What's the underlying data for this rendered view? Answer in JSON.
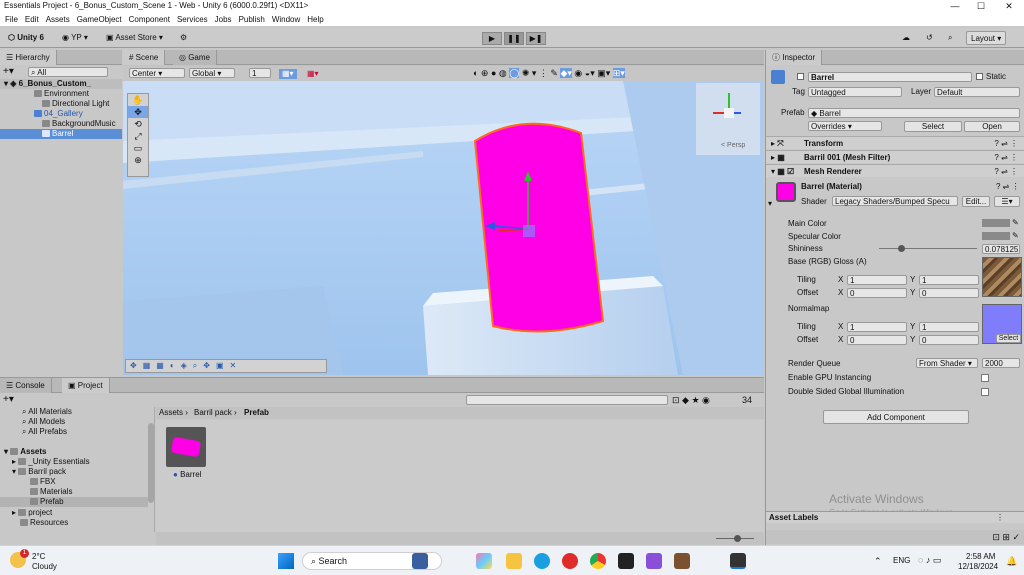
{
  "window": {
    "title": "Essentials Project - 6_Bonus_Custom_Scene 1 - Web - Unity 6 (6000.0.29f1) <DX11>",
    "min": "—",
    "max": "☐",
    "close": "✕"
  },
  "menu": [
    "File",
    "Edit",
    "Assets",
    "GameObject",
    "Component",
    "Services",
    "Jobs",
    "Publish",
    "Window",
    "Help"
  ],
  "toolbar": {
    "unity": "Unity 6",
    "account": "YP",
    "store": "Asset Store",
    "layout": "Layout"
  },
  "hierarchy": {
    "tab": "Hierarchy",
    "search_placeholder": "All",
    "scene": "6_Bonus_Custom_",
    "items": [
      "Environment",
      "Directional Light",
      "04_Gallery",
      "BackgroundMusic",
      "Barrel"
    ]
  },
  "scene": {
    "tab_scene": "Scene",
    "tab_game": "Game",
    "pivot": "Center",
    "space": "Global",
    "snap": "1",
    "gizmo_label": "< Persp"
  },
  "inspector": {
    "tab": "Inspector",
    "object_name": "Barrel",
    "static": "Static",
    "tag_label": "Tag",
    "tag": "Untagged",
    "layer_label": "Layer",
    "layer": "Default",
    "prefab_label": "Prefab",
    "prefab": "Barrel",
    "overrides": "Overrides",
    "select": "Select",
    "open": "Open",
    "components": [
      "Transform",
      "Barril 001 (Mesh Filter)",
      "Mesh Renderer"
    ],
    "material": "Barrel (Material)",
    "shader_label": "Shader",
    "shader": "Legacy Shaders/Bumped Specu",
    "edit": "Edit...",
    "main_color": "Main Color",
    "specular_color": "Specular Color",
    "shininess": "Shininess",
    "shininess_value": "0.078125",
    "shininess_fraction": 0.08,
    "base": "Base (RGB) Gloss (A)",
    "tiling": "Tiling",
    "offset": "Offset",
    "x": "X",
    "y": "Y",
    "base_tiling_x": "1",
    "base_tiling_y": "1",
    "base_offset_x": "0",
    "base_offset_y": "0",
    "normalmap": "Normalmap",
    "normal_tiling_x": "1",
    "normal_tiling_y": "1",
    "normal_offset_x": "0",
    "normal_offset_y": "0",
    "tex_select": "Select",
    "render_queue": "Render Queue",
    "render_queue_mode": "From Shader",
    "render_queue_value": "2000",
    "gpu_instancing": "Enable GPU Instancing",
    "double_sided": "Double Sided Global Illumination",
    "add_component": "Add Component",
    "asset_labels": "Asset Labels",
    "watermark_1": "Activate Windows",
    "watermark_2": "Go to Settings to activate Windows."
  },
  "project": {
    "tab_console": "Console",
    "tab_project": "Project",
    "favorites": [
      "All Materials",
      "All Models",
      "All Prefabs"
    ],
    "assets_root": "Assets",
    "tree": [
      "_Unity Essentials",
      "Barril pack",
      "FBX",
      "Materials",
      "Prefab",
      "project",
      "Resources"
    ],
    "breadcrumb": [
      "Assets",
      "Barril pack",
      "Prefab"
    ],
    "count": "34",
    "asset_name": "Barrel"
  },
  "taskbar": {
    "temp": "2°C",
    "weather": "Cloudy",
    "search": "Search",
    "lang": "ENG",
    "time": "2:58 AM",
    "date": "12/18/2024",
    "badge": "1"
  },
  "colors": {
    "accent": "#5a8fd8",
    "magenta": "#ff00e6",
    "sky": "#a9cdf5"
  }
}
